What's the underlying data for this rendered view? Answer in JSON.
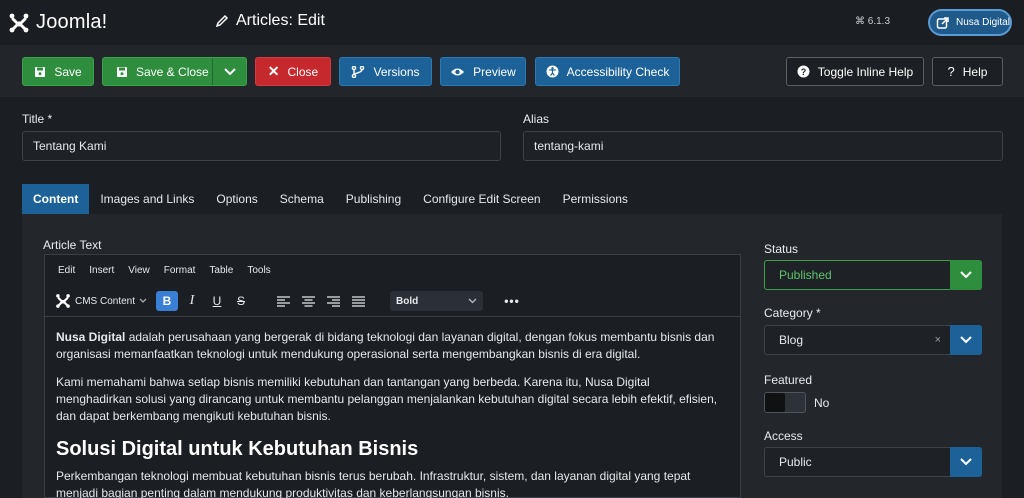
{
  "header": {
    "logo_text": "Joomla!",
    "page_title": "Articles: Edit",
    "version": "6.1.3",
    "site_name": "Nusa Digital"
  },
  "toolbar": {
    "save": "Save",
    "save_close": "Save & Close",
    "close": "Close",
    "versions": "Versions",
    "preview": "Preview",
    "accessibility": "Accessibility Check",
    "toggle_help": "Toggle Inline Help",
    "help": "Help"
  },
  "form": {
    "title_label": "Title *",
    "title_value": "Tentang Kami",
    "alias_label": "Alias",
    "alias_value": "tentang-kami"
  },
  "tabs": [
    "Content",
    "Images and Links",
    "Options",
    "Schema",
    "Publishing",
    "Configure Edit Screen",
    "Permissions"
  ],
  "editor": {
    "label": "Article Text",
    "menu": [
      "Edit",
      "Insert",
      "View",
      "Format",
      "Table",
      "Tools"
    ],
    "cms_content": "CMS Content",
    "block_format": "Bold",
    "p1_bold": "Nusa Digital",
    "p1_rest": " adalah perusahaan yang bergerak di bidang teknologi dan layanan digital, dengan fokus membantu bisnis dan organisasi memanfaatkan teknologi untuk mendukung operasional serta mengembangkan bisnis di era digital.",
    "p2": "Kami memahami bahwa setiap bisnis memiliki kebutuhan dan tantangan yang berbeda. Karena itu, Nusa Digital menghadirkan solusi yang dirancang untuk membantu pelanggan menjalankan kebutuhan digital secara lebih efektif, efisien, dan dapat berkembang mengikuti kebutuhan bisnis.",
    "h2": "Solusi Digital untuk Kebutuhan Bisnis",
    "p3": "Perkembangan teknologi membuat kebutuhan bisnis terus berubah. Infrastruktur, sistem, dan layanan digital yang tepat menjadi bagian penting dalam mendukung produktivitas dan keberlangsungan bisnis."
  },
  "sidebar": {
    "status_label": "Status",
    "status_value": "Published",
    "category_label": "Category *",
    "category_value": "Blog",
    "featured_label": "Featured",
    "featured_value": "No",
    "access_label": "Access",
    "access_value": "Public"
  },
  "colors": {
    "green": "#2e8e3e",
    "red": "#c5282d",
    "blue": "#1c6299",
    "published_text": "#5fc46b"
  }
}
